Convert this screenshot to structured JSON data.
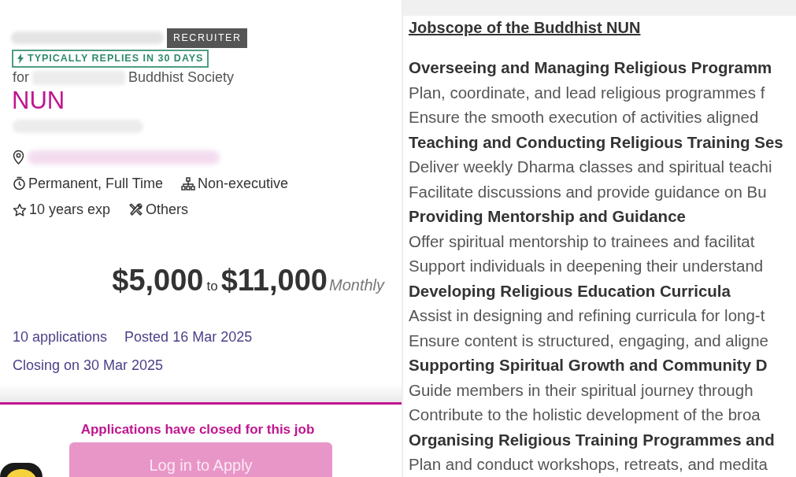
{
  "recruiter_card": {
    "badge": "RECRUITER",
    "reply_badge": "TYPICALLY REPLIES IN 30 DAYS",
    "for_label": "for",
    "company_suffix": "Buddhist Society"
  },
  "job_title": "NUN",
  "detail_rows": [
    [
      {
        "kind": "clock",
        "text": "Permanent, Full Time"
      },
      {
        "kind": "hierarchy",
        "text": "Non-executive"
      }
    ],
    [
      {
        "kind": "star",
        "text": "10 years exp"
      },
      {
        "kind": "tools",
        "text": "Others"
      }
    ]
  ],
  "salary": {
    "min": "$5,000",
    "to": "to",
    "max": "$11,000",
    "period": "Monthly"
  },
  "stats": [
    "10 applications",
    "Posted 16 Mar 2025",
    "Closing on 30 Mar 2025"
  ],
  "closed_notice": "Applications have closed for this job",
  "apply_button": {
    "label": "Log in to Apply",
    "disabled": true
  },
  "jobscope": {
    "title": "Jobscope of the Buddhist NUN",
    "lines": [
      {
        "kind": "heading",
        "text": "Overseeing and Managing Religious Programm"
      },
      {
        "kind": "body",
        "text": "Plan, coordinate, and lead religious programmes f"
      },
      {
        "kind": "body",
        "text": "Ensure the smooth execution of activities aligned"
      },
      {
        "kind": "heading",
        "text": "Teaching and Conducting Religious Training Ses"
      },
      {
        "kind": "body",
        "text": "Deliver weekly Dharma classes and spiritual teachi"
      },
      {
        "kind": "body",
        "text": "Facilitate discussions and provide guidance on Bu"
      },
      {
        "kind": "heading",
        "text": "Providing Mentorship and Guidance"
      },
      {
        "kind": "body",
        "text": "Offer spiritual mentorship to trainees and facilitat"
      },
      {
        "kind": "body",
        "text": "Support individuals in deepening their understand"
      },
      {
        "kind": "heading",
        "text": "Developing Religious Education Curricula"
      },
      {
        "kind": "body",
        "text": "Assist in designing and refining curricula for long-t"
      },
      {
        "kind": "body",
        "text": "Ensure content is structured, engaging, and aligne"
      },
      {
        "kind": "heading",
        "text": "Supporting Spiritual Growth and Community D"
      },
      {
        "kind": "body",
        "text": "Guide members in their spiritual journey through"
      },
      {
        "kind": "body",
        "text": "Contribute to the holistic development of the broa"
      },
      {
        "kind": "heading",
        "text": "Organising Religious Training Programmes and"
      },
      {
        "kind": "body",
        "text": "Plan and conduct workshops, retreats, and medita"
      }
    ]
  }
}
